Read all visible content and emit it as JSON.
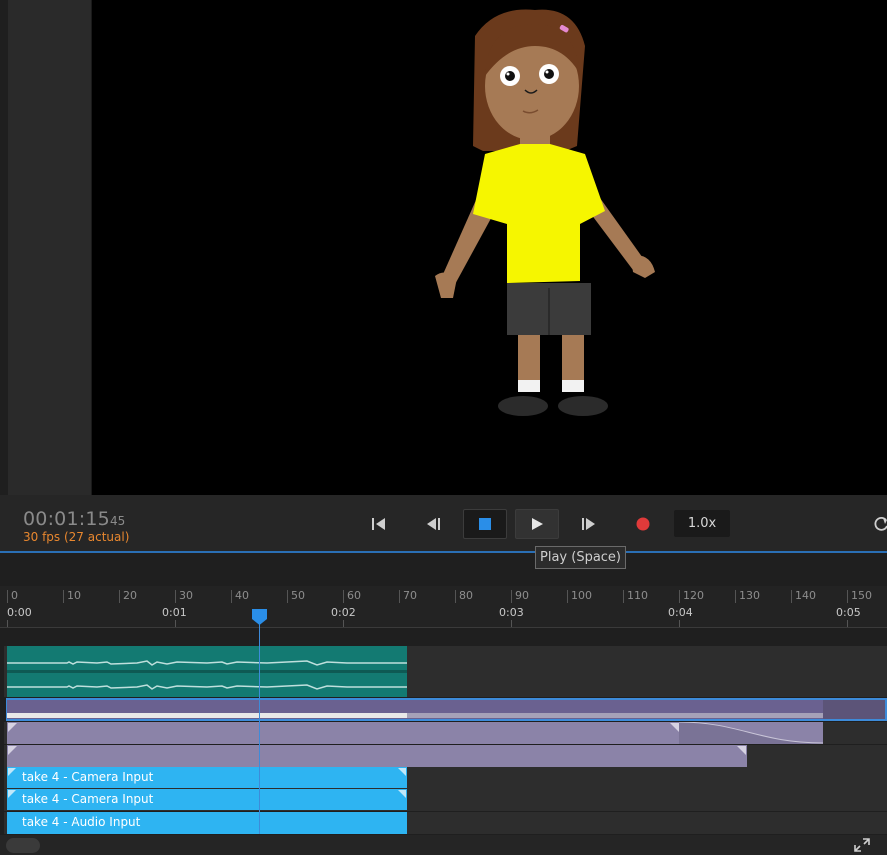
{
  "transport": {
    "timecode": "00:01:15",
    "frame": "45",
    "fps_text": "30 fps (27 actual)",
    "speed": "1.0x",
    "buttons": {
      "go_start_icon": "go-to-start-icon",
      "step_back_icon": "step-back-icon",
      "stop_icon": "stop-icon",
      "play_icon": "play-icon",
      "step_forward_icon": "step-forward-icon",
      "record_icon": "record-icon"
    },
    "tooltip": "Play (Space)"
  },
  "ruler": {
    "frames": [
      "0",
      "10",
      "20",
      "30",
      "40",
      "50",
      "60",
      "70",
      "80",
      "90",
      "100",
      "110",
      "120",
      "130",
      "140",
      "150"
    ],
    "times": [
      "0:00",
      "0:01",
      "0:02",
      "0:03",
      "0:04",
      "0:05"
    ]
  },
  "tracks": {
    "take_camera_1": "take 4 - Camera Input",
    "take_camera_2": "take 4 - Camera Input",
    "take_audio": "take 4 - Audio Input"
  },
  "colors": {
    "accent": "#3d8bd9",
    "audio_clip": "#137a72",
    "take_clip": "#2eb4f2",
    "puppet_clip": "#8b83a8",
    "fps_text": "#e8872f",
    "record": "#e03a3a"
  }
}
